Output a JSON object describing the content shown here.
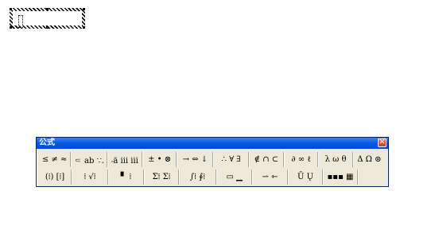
{
  "window": {
    "title": "公式",
    "close_glyph": "✕"
  },
  "toolbar": {
    "row1": [
      {
        "name": "relational-symbols",
        "glyphs": "≤ ≠ ≈"
      },
      {
        "name": "spaces-and-ellipses",
        "glyphs": "⸦ ab ∵."
      },
      {
        "name": "embellishments",
        "glyphs": "⸳ä ⅲ ⅲ"
      },
      {
        "name": "operator-symbols",
        "glyphs": "± • ⊗"
      },
      {
        "name": "arrow-symbols",
        "glyphs": "→ ⇔ ↓"
      },
      {
        "name": "logical-symbols",
        "glyphs": "∴ ∀ ∃"
      },
      {
        "name": "set-theory-symbols",
        "glyphs": "∉ ∩ ⊂"
      },
      {
        "name": "miscellaneous-symbols",
        "glyphs": "∂ ∞ ℓ"
      },
      {
        "name": "greek-lowercase",
        "glyphs": "λ ω θ"
      },
      {
        "name": "greek-uppercase",
        "glyphs": "Δ Ω ⊚"
      }
    ],
    "row2": [
      {
        "name": "fence-templates",
        "glyphs": "(⁞) [⁞]"
      },
      {
        "name": "fraction-radical-templates",
        "glyphs": "⁞ √⁞"
      },
      {
        "name": "subscript-superscript-templates",
        "glyphs": "▘ ⁞"
      },
      {
        "name": "summation-templates",
        "glyphs": "Σ⁞ Σ⁞"
      },
      {
        "name": "integral-templates",
        "glyphs": "∫⁞ ∮⁞"
      },
      {
        "name": "underbar-overbar-templates",
        "glyphs": "▭ ▁"
      },
      {
        "name": "labeled-arrow-templates",
        "glyphs": "⇀ ⇽"
      },
      {
        "name": "products-set-theory-templates",
        "glyphs": "Ū Ų"
      },
      {
        "name": "matrix-templates",
        "glyphs": "▪▪▪ ▦"
      }
    ]
  }
}
